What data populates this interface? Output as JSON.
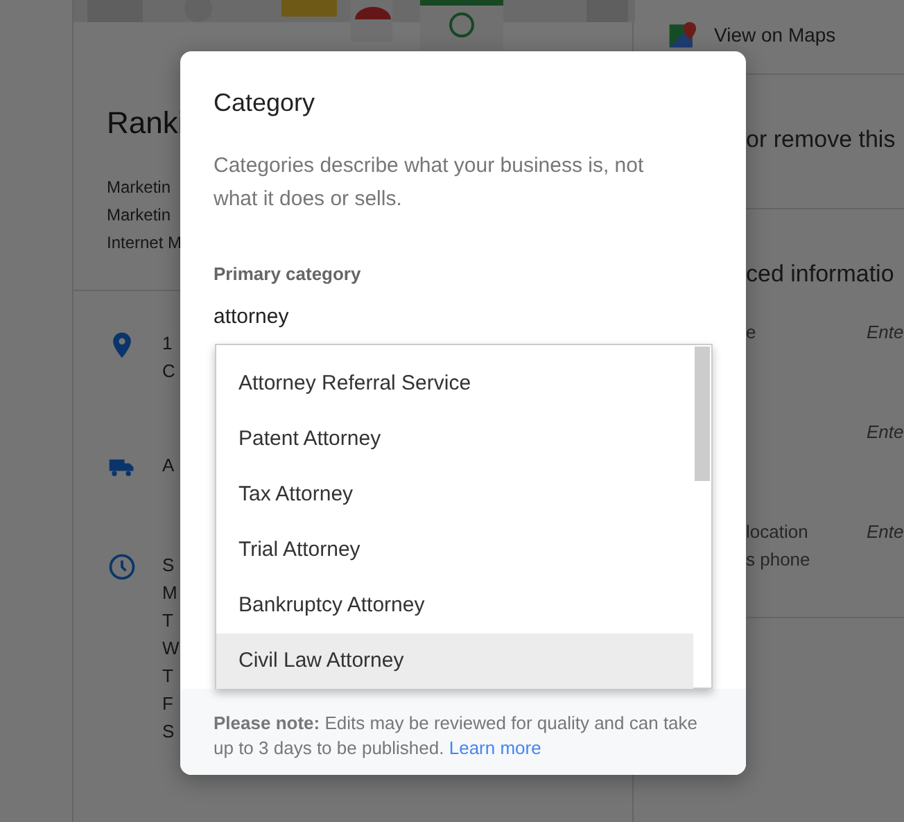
{
  "business": {
    "name": "Ranki",
    "categories": [
      "Marketin",
      "Marketin",
      "Internet M"
    ],
    "address_lines": [
      "1",
      "C"
    ],
    "delivery": "A",
    "hours": [
      "S",
      "M",
      "T",
      "W",
      "T",
      "F",
      "S"
    ]
  },
  "side": {
    "maps_link": "View on Maps",
    "remove_text": "or remove this",
    "advanced_title": "ced informatio",
    "fields": [
      {
        "label_lines": [
          "e"
        ],
        "placeholder": "Ente"
      },
      {
        "placeholder": "Ente"
      },
      {
        "label_lines": [
          "location",
          "s phone"
        ],
        "placeholder": "Ente"
      }
    ]
  },
  "dialog": {
    "title": "Category",
    "description": "Categories describe what your business is, not what it does or sells.",
    "field_label": "Primary category",
    "value": "attorney",
    "options": [
      {
        "label": "Attorney Referral Service",
        "selected": false
      },
      {
        "label": "Patent Attorney",
        "selected": false
      },
      {
        "label": "Tax Attorney",
        "selected": false
      },
      {
        "label": "Trial Attorney",
        "selected": false
      },
      {
        "label": "Bankruptcy Attorney",
        "selected": false
      },
      {
        "label": "Civil Law Attorney",
        "selected": true
      }
    ],
    "note": "**Please note:** Edits may be reviewed for quality and can take up to 3 days to be published.",
    "link": "Learn more"
  }
}
